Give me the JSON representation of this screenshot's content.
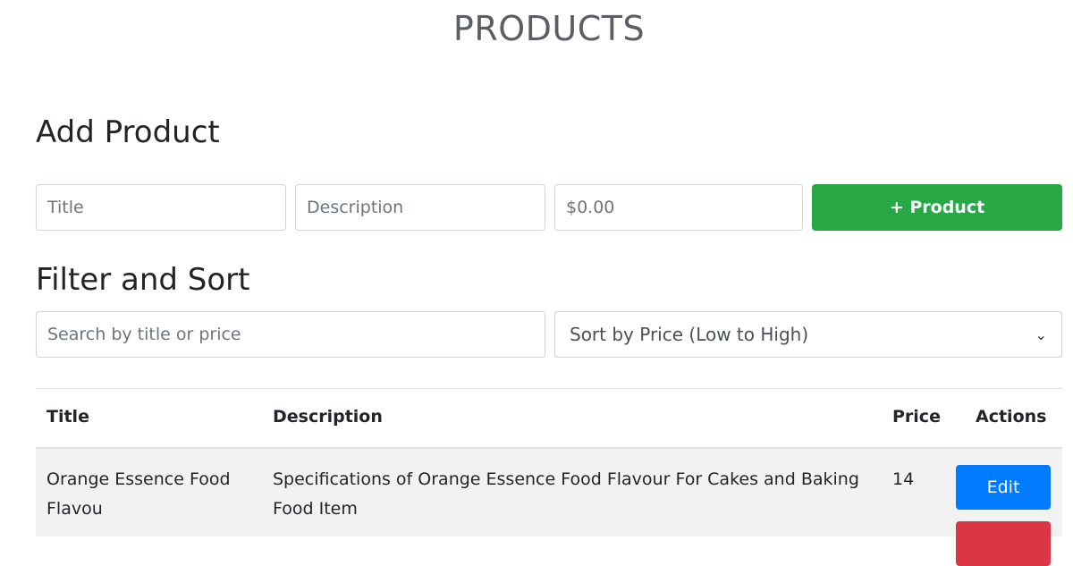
{
  "page": {
    "title": "PRODUCTS"
  },
  "add_product": {
    "heading": "Add Product",
    "title_placeholder": "Title",
    "description_placeholder": "Description",
    "price_placeholder": "$0.00",
    "add_button_label": "+ Product",
    "add_button_color": "#28a745"
  },
  "filter_sort": {
    "heading": "Filter and Sort",
    "search_placeholder": "Search by title or price",
    "sort_selected": "Sort by Price (Low to High)"
  },
  "table": {
    "headers": [
      "Title",
      "Description",
      "Price",
      "Actions"
    ],
    "rows": [
      {
        "title": "Orange Essence Food Flavou",
        "description": "Specifications of Orange Essence Food Flavour For Cakes and Baking Food Item",
        "price": "14",
        "edit_label": "Edit"
      }
    ]
  },
  "colors": {
    "edit": "#007bff",
    "delete": "#dc3545"
  }
}
